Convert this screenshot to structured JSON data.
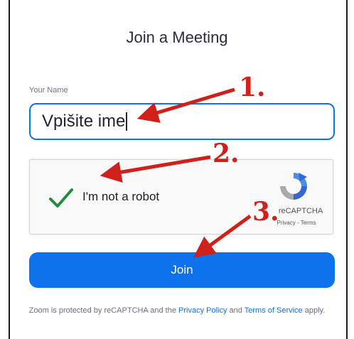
{
  "page": {
    "title": "Join a Meeting"
  },
  "name_field": {
    "label": "Your Name",
    "value": "Vpišite ime"
  },
  "captcha": {
    "label": "I'm not a robot",
    "brand": "reCAPTCHA",
    "privacy": "Privacy",
    "separator": "-",
    "terms": "Terms",
    "checked": true
  },
  "join_button": {
    "label": "Join"
  },
  "footer": {
    "prefix": "Zoom is protected by reCAPTCHA and the",
    "privacy_link": "Privacy Policy",
    "and": "and",
    "terms_link": "Terms of Service",
    "suffix": "apply."
  },
  "annotations": {
    "step1": "1.",
    "step2": "2.",
    "step3": "3."
  },
  "colors": {
    "accent": "#0e72ed",
    "arrow": "#d0201a",
    "check": "#1e8e3e"
  }
}
